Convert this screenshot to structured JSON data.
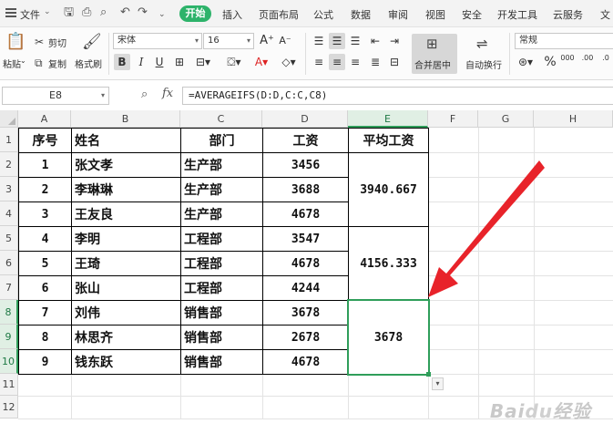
{
  "menubar": {
    "file": "文件",
    "tabs": [
      "开始",
      "插入",
      "页面布局",
      "公式",
      "数据",
      "审阅",
      "视图",
      "安全",
      "开发工具",
      "云服务",
      "文"
    ]
  },
  "ribbon": {
    "paste": "粘贴",
    "cut": "剪切",
    "copy": "复制",
    "format_painter": "格式刷",
    "font_name": "宋体",
    "font_size": "16",
    "merge_center": "合并居中",
    "wrap_text": "自动换行",
    "number_format": "常规",
    "grow_font": "A⁺",
    "shrink_font": "A⁻"
  },
  "formula_bar": {
    "name_box": "E8",
    "fx": "fx",
    "formula": "=AVERAGEIFS(D:D,C:C,C8)"
  },
  "columns": [
    "A",
    "B",
    "C",
    "D",
    "E",
    "F",
    "G",
    "H"
  ],
  "rows": [
    "1",
    "2",
    "3",
    "4",
    "5",
    "6",
    "7",
    "8",
    "9",
    "10",
    "11",
    "12"
  ],
  "table": {
    "headers": [
      "序号",
      "姓名",
      "部门",
      "工资",
      "平均工资"
    ],
    "rows": [
      [
        "1",
        "张文孝",
        "生产部",
        "3456"
      ],
      [
        "2",
        "李琳琳",
        "生产部",
        "3688"
      ],
      [
        "3",
        "王友良",
        "生产部",
        "4678"
      ],
      [
        "4",
        "李明",
        "工程部",
        "3547"
      ],
      [
        "5",
        "王琦",
        "工程部",
        "4678"
      ],
      [
        "6",
        "张山",
        "工程部",
        "4244"
      ],
      [
        "7",
        "刘伟",
        "销售部",
        "3678"
      ],
      [
        "8",
        "林思齐",
        "销售部",
        "2678"
      ],
      [
        "9",
        "钱东跃",
        "销售部",
        "4678"
      ]
    ],
    "averages": [
      "3940.667",
      "4156.333",
      "3678"
    ]
  },
  "selected_cell": "E8",
  "watermark": "Baidu经验",
  "colors": {
    "accent": "#2db36a",
    "selection": "#2f9e5a",
    "arrow": "#e8232a"
  },
  "icons": [
    "menu-icon",
    "save-icon",
    "print-icon",
    "print-preview-icon",
    "undo-icon",
    "redo-icon",
    "paste-icon",
    "scissors-icon",
    "copy-icon",
    "brush-icon",
    "bold-icon",
    "italic-icon",
    "underline-icon",
    "border-icon",
    "fill-color-icon",
    "font-color-icon",
    "eraser-icon",
    "align-icon",
    "merge-icon",
    "wrap-icon",
    "percent-icon",
    "zoom-icon",
    "fx-icon",
    "red-arrow-annotation"
  ]
}
